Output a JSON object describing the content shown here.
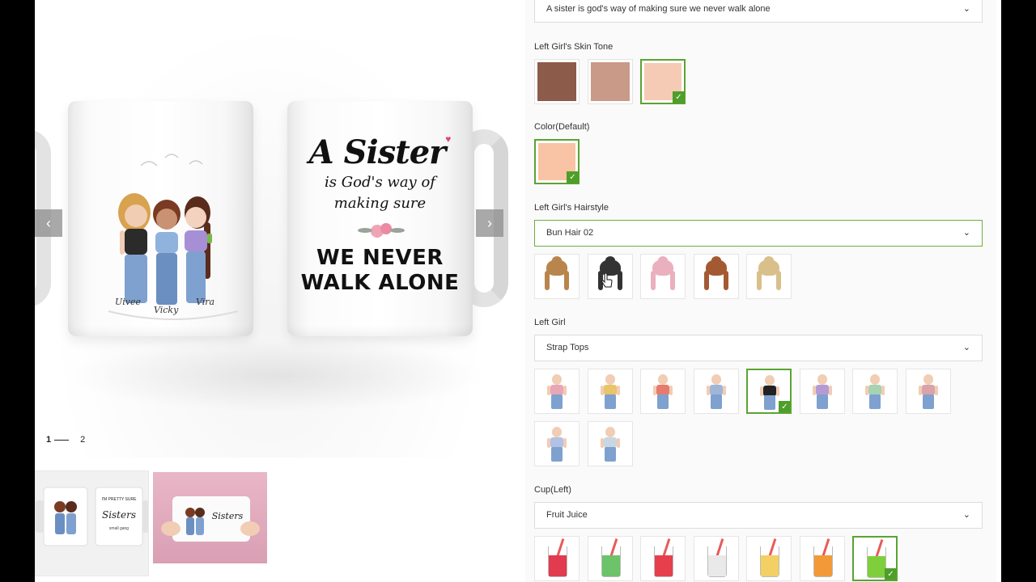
{
  "gallery": {
    "quote": {
      "line1": "A Sister",
      "line2": "is God's way of",
      "line3": "making sure",
      "line4": "WE NEVER",
      "line5": "WALK ALONE"
    },
    "names": [
      "Uivee",
      "Vicky",
      "Vira"
    ],
    "pager": {
      "current": "1",
      "next": "2"
    },
    "thumb1": {
      "text1": "I'M PRETTY SURE WE ARE MORE THAN",
      "text2": "Sisters"
    }
  },
  "options": {
    "quote_select": "A sister is god's way of making sure we never walk alone",
    "skin_tone": {
      "label": "Left Girl's Skin Tone",
      "swatches": [
        "#8d5b4a",
        "#c99a87",
        "#f6cbb6"
      ],
      "selected_index": 2
    },
    "color": {
      "label": "Color(Default)",
      "swatches": [
        "#f9c3a6"
      ],
      "selected_index": 0
    },
    "hairstyle": {
      "label": "Left Girl's Hairstyle",
      "selected": "Bun Hair 02",
      "tiles": [
        {
          "name": "brown-light",
          "color": "#b8854c"
        },
        {
          "name": "black",
          "color": "#333333"
        },
        {
          "name": "pink",
          "color": "#eab0bd"
        },
        {
          "name": "auburn",
          "color": "#a35a33"
        },
        {
          "name": "blonde",
          "color": "#d9c08a"
        }
      ]
    },
    "outfit": {
      "label": "Left Girl",
      "selected": "Strap Tops",
      "tiles": [
        {
          "top": "#e9a7b6"
        },
        {
          "top": "#e8c46a"
        },
        {
          "top": "#e77b6c"
        },
        {
          "top": "#9fb6d9"
        },
        {
          "top": "#222222"
        },
        {
          "top": "#b69ad6"
        },
        {
          "top": "#a7d3b2"
        },
        {
          "top": "#d9a3a8"
        },
        {
          "top": "#b2c2e6"
        },
        {
          "top": "#c9d7e3"
        }
      ],
      "selected_index": 4
    },
    "cup": {
      "label": "Cup(Left)",
      "selected": "Fruit Juice",
      "tiles": [
        {
          "liquid": "#e23a4f"
        },
        {
          "liquid": "#6cc36a"
        },
        {
          "liquid": "#e5404c"
        },
        {
          "liquid": "#e9e9e9"
        },
        {
          "liquid": "#f2d063"
        },
        {
          "liquid": "#f29a38"
        },
        {
          "liquid": "#7fcf3c"
        }
      ],
      "selected_index": 6
    },
    "chevron": "⌄",
    "check": "✓"
  },
  "nav": {
    "prev": "‹",
    "next": "›"
  }
}
